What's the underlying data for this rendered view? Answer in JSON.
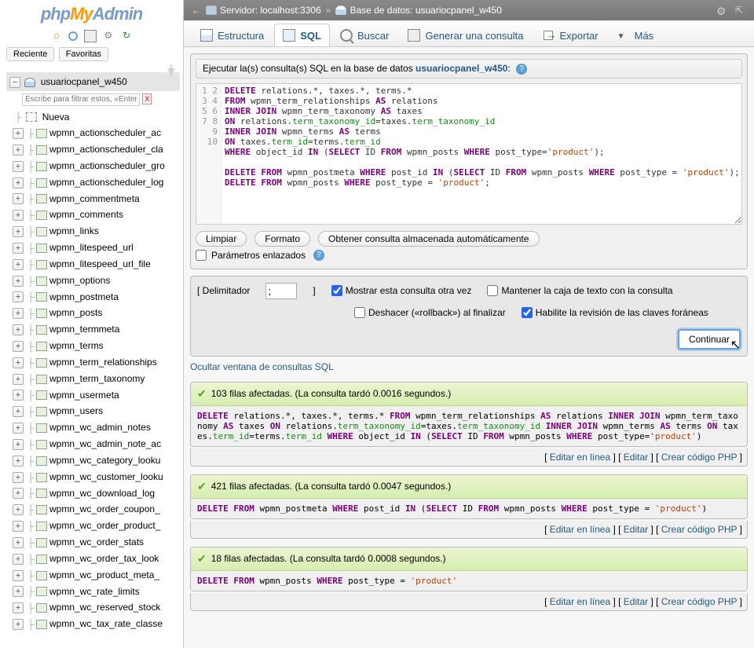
{
  "logo": {
    "php": "php",
    "my": "My",
    "admin": "Admin"
  },
  "sidebar": {
    "tabs": {
      "recent": "Reciente",
      "favorites": "Favoritas"
    },
    "database": "usuariocpanel_w450",
    "filter_placeholder": "Escribe para filtrar estos, «Enter» para",
    "new_label": "Nueva",
    "tables": [
      "wpmn_actionscheduler_ac",
      "wpmn_actionscheduler_cla",
      "wpmn_actionscheduler_gro",
      "wpmn_actionscheduler_log",
      "wpmn_commentmeta",
      "wpmn_comments",
      "wpmn_links",
      "wpmn_litespeed_url",
      "wpmn_litespeed_url_file",
      "wpmn_options",
      "wpmn_postmeta",
      "wpmn_posts",
      "wpmn_termmeta",
      "wpmn_terms",
      "wpmn_term_relationships",
      "wpmn_term_taxonomy",
      "wpmn_usermeta",
      "wpmn_users",
      "wpmn_wc_admin_notes",
      "wpmn_wc_admin_note_ac",
      "wpmn_wc_category_looku",
      "wpmn_wc_customer_looku",
      "wpmn_wc_download_log",
      "wpmn_wc_order_coupon_",
      "wpmn_wc_order_product_",
      "wpmn_wc_order_stats",
      "wpmn_wc_order_tax_look",
      "wpmn_wc_product_meta_",
      "wpmn_wc_rate_limits",
      "wpmn_wc_reserved_stock",
      "wpmn_wc_tax_rate_classe"
    ]
  },
  "breadcrumb": {
    "server_label": "Servidor: localhost:3306",
    "db_label": "Base de datos: usuariocpanel_w450"
  },
  "tabs": {
    "structure": "Estructura",
    "sql": "SQL",
    "search": "Buscar",
    "generate": "Generar una consulta",
    "export": "Exportar",
    "more": "Más"
  },
  "fieldset": {
    "title_prefix": "Ejecutar la(s) consulta(s) SQL en la base de datos ",
    "db": "usuariocpanel_w450",
    "title_suffix": ":"
  },
  "editor": {
    "lines": [
      "1",
      "2",
      "3",
      "4",
      "5",
      "6",
      "7",
      "8",
      "9",
      "10"
    ]
  },
  "buttons": {
    "clear": "Limpiar",
    "format": "Formato",
    "auto": "Obtener consulta almacenada automáticamente",
    "continue": "Continuar"
  },
  "checks": {
    "bound_params": "Parámetros enlazados",
    "delimiter_label": "Delimitador",
    "delimiter_value": ";",
    "show_again": "Mostrar esta consulta otra vez",
    "keep_box": "Mantener la caja de texto con la consulta",
    "rollback": "Deshacer («rollback») al finalizar",
    "fk": "Habilite la revisión de las claves foráneas"
  },
  "toggle_link": "Ocultar ventana de consultas SQL",
  "results": [
    {
      "head": "103 filas afectadas. (La consulta tardó 0.0016 segundos.)"
    },
    {
      "head": "421 filas afectadas. (La consulta tardó 0.0047 segundos.)"
    },
    {
      "head": "18 filas afectadas. (La consulta tardó 0.0008 segundos.)"
    }
  ],
  "actions": {
    "edit_inline": "Editar en línea",
    "edit": "Editar",
    "php": "Crear código PHP"
  }
}
